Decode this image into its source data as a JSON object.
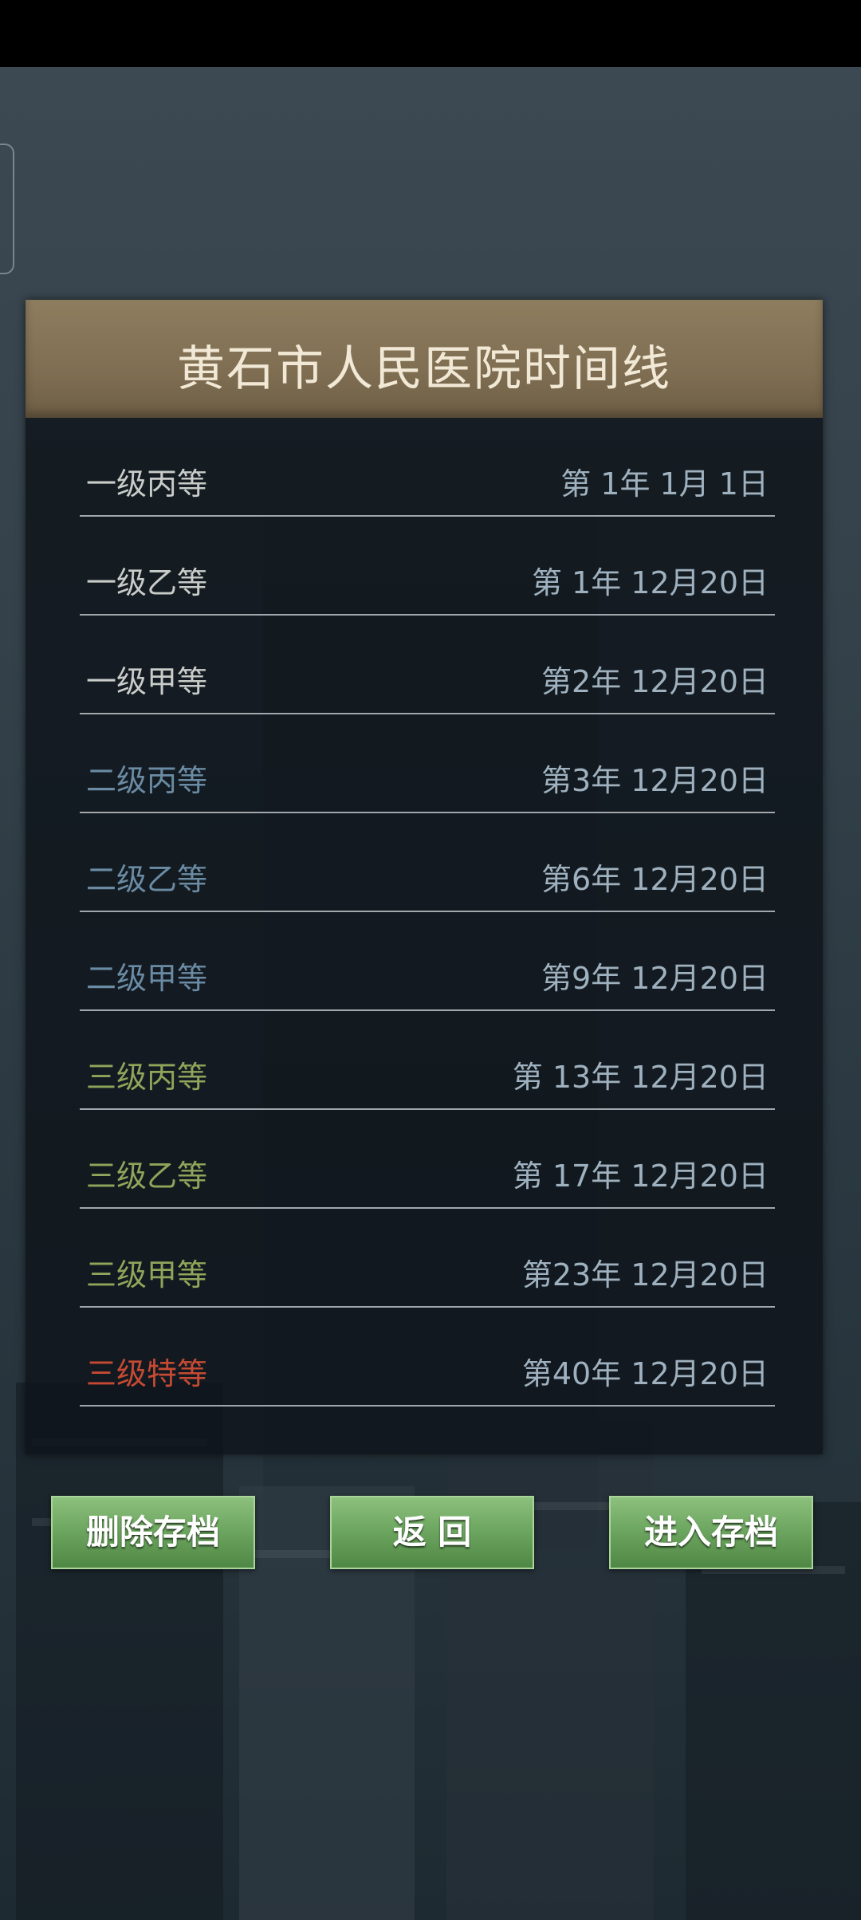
{
  "panel": {
    "title": "黄石市人民医院时间线"
  },
  "timeline": [
    {
      "level": "一级丙等",
      "date": "第 1年 1月 1日",
      "color": "#c9ccc8"
    },
    {
      "level": "一级乙等",
      "date": "第 1年 12月20日",
      "color": "#c9ccc8"
    },
    {
      "level": "一级甲等",
      "date": "第2年 12月20日",
      "color": "#c9ccc8"
    },
    {
      "level": "二级丙等",
      "date": "第3年 12月20日",
      "color": "#6a8ba3"
    },
    {
      "level": "二级乙等",
      "date": "第6年 12月20日",
      "color": "#6a8ba3"
    },
    {
      "level": "二级甲等",
      "date": "第9年 12月20日",
      "color": "#6a8ba3"
    },
    {
      "level": "三级丙等",
      "date": "第 13年 12月20日",
      "color": "#8fa55a"
    },
    {
      "level": "三级乙等",
      "date": "第 17年 12月20日",
      "color": "#8fa55a"
    },
    {
      "level": "三级甲等",
      "date": "第23年 12月20日",
      "color": "#8fa55a"
    },
    {
      "level": "三级特等",
      "date": "第40年 12月20日",
      "color": "#c64a33"
    }
  ],
  "buttons": {
    "delete_label": "删除存档",
    "back_label": "返 回",
    "enter_label": "进入存档"
  }
}
